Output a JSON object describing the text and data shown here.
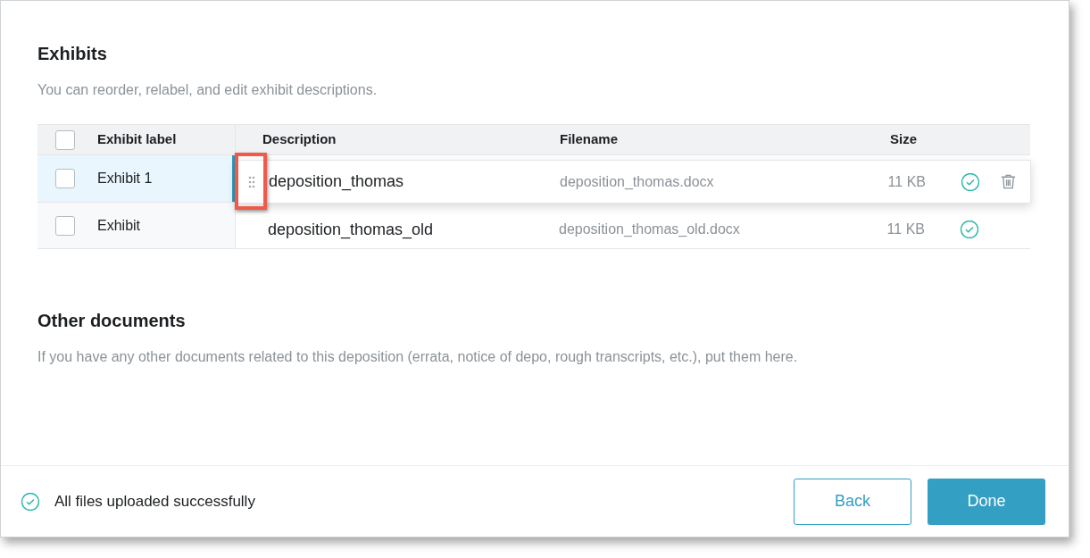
{
  "exhibits": {
    "title": "Exhibits",
    "subtitle": "You can reorder, relabel, and edit exhibit descriptions."
  },
  "table": {
    "columns": [
      "Exhibit label",
      "Description",
      "Filename",
      "Size"
    ],
    "header_checked": false,
    "rows": [
      {
        "label": "Exhibit 1",
        "checked": false,
        "selected": true
      },
      {
        "label": "Exhibit",
        "checked": false,
        "selected": false,
        "description": "deposition_thomas_old",
        "filename": "deposition_thomas_old.docx",
        "size": "11 KB",
        "uploaded": true
      }
    ],
    "dragged_row": {
      "description": "deposition_thomas",
      "filename": "deposition_thomas.docx",
      "size": "11 KB",
      "uploaded": true,
      "highlighted_handle": true
    }
  },
  "other_documents": {
    "title": "Other documents",
    "subtitle": "If you have any other documents related to this deposition (errata, notice of depo, rough transcripts, etc.), put them here."
  },
  "footer": {
    "status": "All files uploaded successfully",
    "buttons": [
      {
        "label": "Back",
        "kind": "secondary"
      },
      {
        "label": "Done",
        "kind": "primary"
      }
    ]
  }
}
